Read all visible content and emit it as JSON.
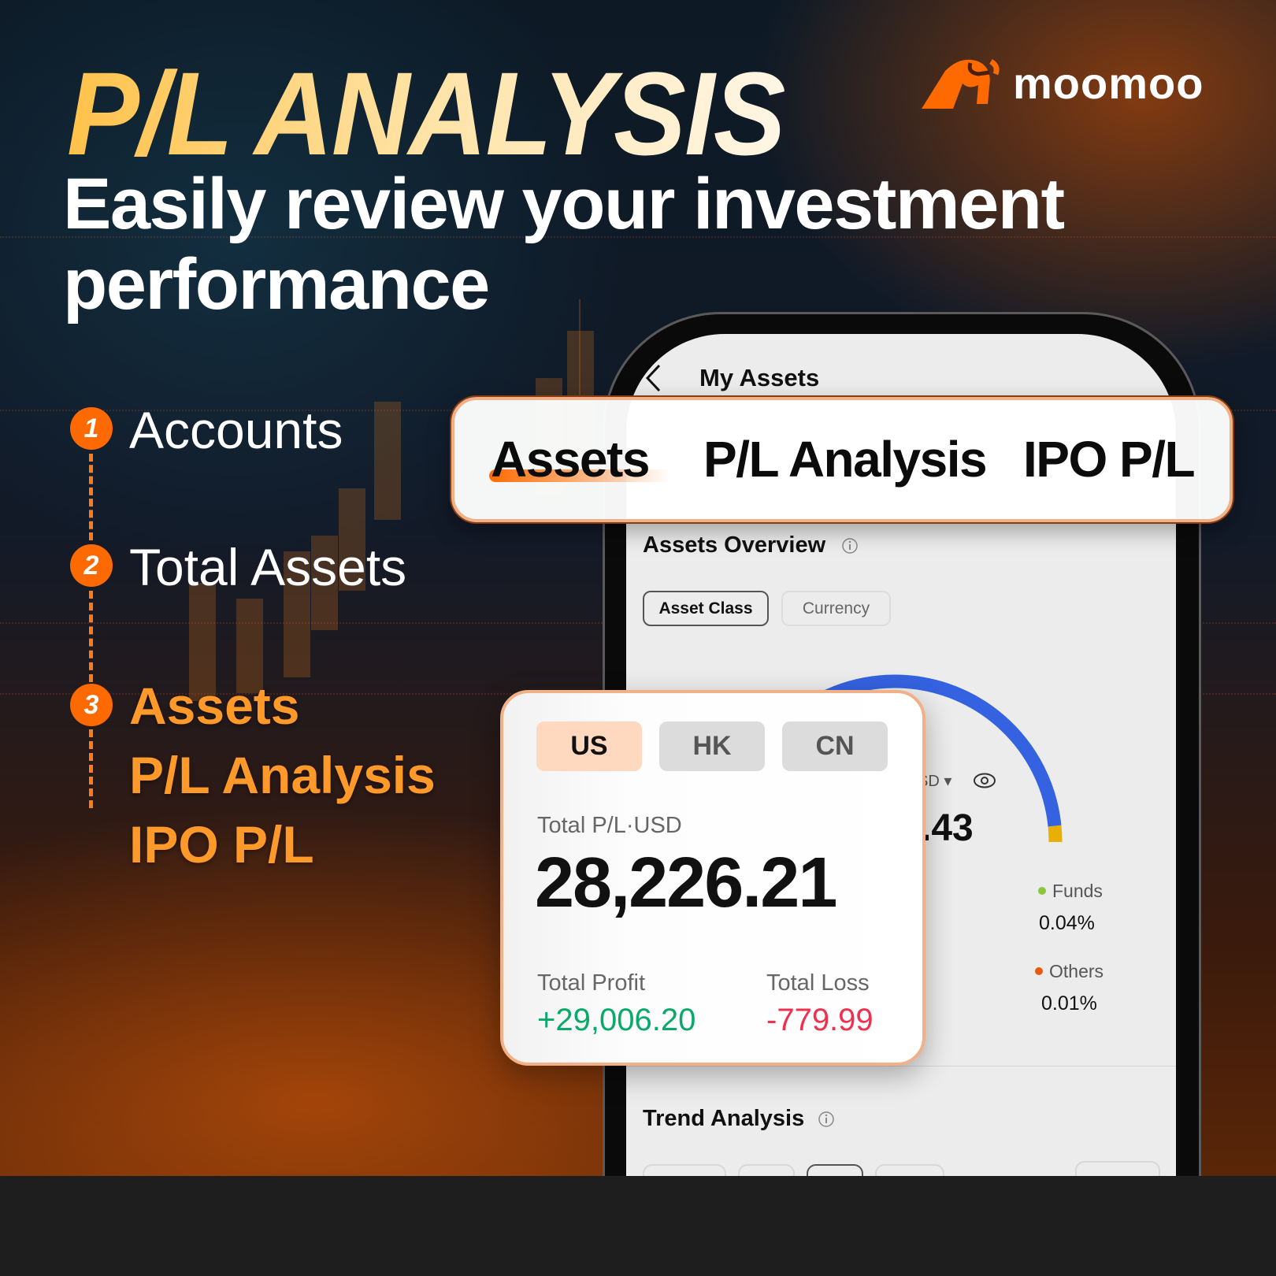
{
  "hero": {
    "title": "P/L ANALYSIS",
    "subtitle": "Easily review your investment performance"
  },
  "brand": {
    "name": "moomoo",
    "logo_icon": "bull-head-icon",
    "accent": "#ff6a00"
  },
  "steps": [
    {
      "number": "1",
      "label": "Accounts"
    },
    {
      "number": "2",
      "label": "Total Assets"
    },
    {
      "number": "3",
      "labels": [
        "Assets",
        "P/L Analysis",
        "IPO P/L"
      ]
    }
  ],
  "app": {
    "header": {
      "back_icon": "chevron-left-icon",
      "title": "My Assets"
    },
    "tabs": [
      {
        "label": "Assets",
        "active": true
      },
      {
        "label": "P/L Analysis",
        "active": false
      },
      {
        "label": "IPO P/L",
        "active": false
      }
    ],
    "overview": {
      "title": "Assets Overview",
      "chips": [
        {
          "label": "Asset Class",
          "active": true
        },
        {
          "label": "Currency",
          "active": false
        }
      ],
      "currency_fragment": "SD",
      "value_fragment": ".43",
      "allocation": [
        {
          "label": "Funds",
          "value": "0.04%",
          "color": "#8cc63f"
        },
        {
          "label": "Others",
          "value": "0.01%",
          "color": "#e85a0c"
        }
      ],
      "gauge_colors": {
        "main": "#3462e0",
        "end": "#e8b000"
      }
    },
    "trend": {
      "title": "Trend Analysis"
    }
  },
  "pl_card": {
    "markets": [
      {
        "label": "US",
        "active": true
      },
      {
        "label": "HK",
        "active": false
      },
      {
        "label": "CN",
        "active": false
      }
    ],
    "total_label": "Total P/L·USD",
    "total_value": "28,226.21",
    "profit_label": "Total Profit",
    "profit_value": "+29,006.20",
    "loss_label": "Total Loss",
    "loss_value": "-779.99",
    "colors": {
      "profit": "#0aa96a",
      "loss": "#f0304f"
    }
  }
}
